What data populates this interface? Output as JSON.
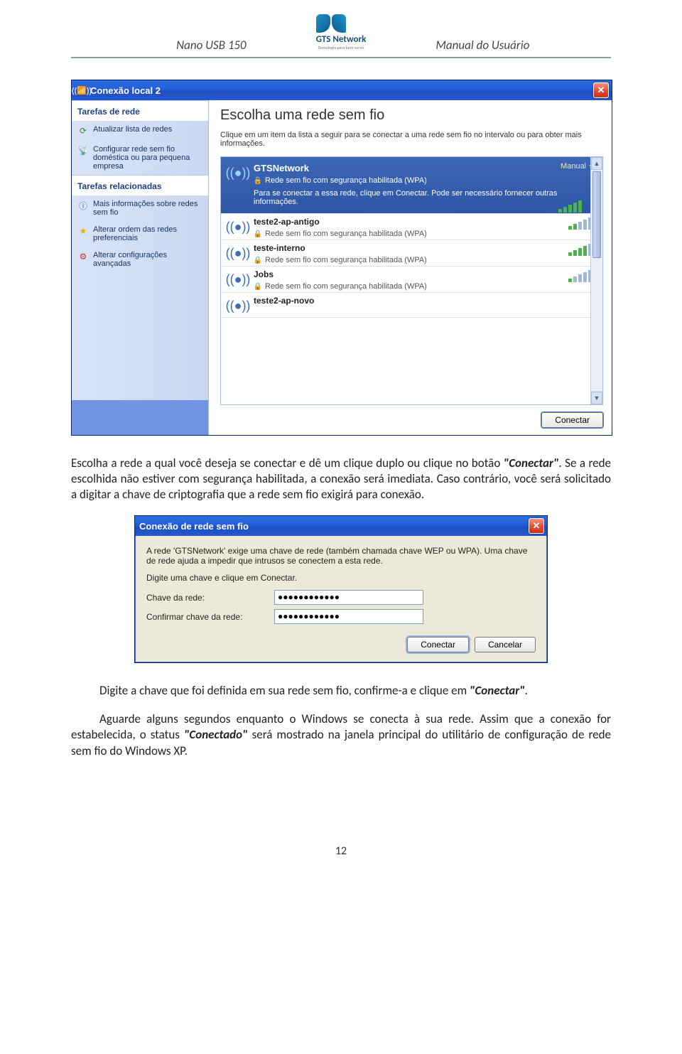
{
  "header": {
    "left": "Nano USB 150",
    "logo_text": "GTS Network",
    "logo_sub": "Tecnologia para bem servir",
    "right": "Manual do Usuário"
  },
  "win1": {
    "title": "Conexão local 2",
    "sidebar": {
      "section1": "Tarefas de rede",
      "items1": [
        {
          "label": "Atualizar lista de redes",
          "icon": "↻"
        },
        {
          "label": "Configurar rede sem fio doméstica ou para pequena empresa",
          "icon": "📶"
        }
      ],
      "section2": "Tarefas relacionadas",
      "items2": [
        {
          "label": "Mais informações sobre redes sem fio",
          "icon": "ℹ"
        },
        {
          "label": "Alterar ordem das redes preferenciais",
          "icon": "★"
        },
        {
          "label": "Alterar configurações avançadas",
          "icon": "⚙"
        }
      ]
    },
    "main": {
      "title": "Escolha uma rede sem fio",
      "subtitle": "Clique em um item da lista a seguir para se conectar a uma rede sem fio no intervalo ou para obter mais informações.",
      "selected": {
        "name": "GTSNetwork",
        "badge": "Manual",
        "security": "Rede sem fio com segurança habilitada (WPA)",
        "desc": "Para se conectar a essa rede, clique em Conectar. Pode ser necessário fornecer outras informações.",
        "bars": [
          1,
          1,
          1,
          1,
          1
        ]
      },
      "rows": [
        {
          "name": "teste2-ap-antigo",
          "sec": "Rede sem fio com segurança habilitada (WPA)",
          "bars": [
            1,
            1,
            0,
            0,
            0
          ]
        },
        {
          "name": "teste-interno",
          "sec": "Rede sem fio com segurança habilitada (WPA)",
          "bars": [
            1,
            1,
            1,
            1,
            0
          ]
        },
        {
          "name": "Jobs",
          "sec": "Rede sem fio com segurança habilitada (WPA)",
          "bars": [
            1,
            0,
            0,
            0,
            0
          ]
        },
        {
          "name": "teste2-ap-novo",
          "sec": "",
          "bars": []
        }
      ],
      "connect_btn": "Conectar"
    }
  },
  "para1": {
    "t1": "Escolha a rede a qual você deseja se conectar e dê um clique duplo ou clique no botão ",
    "b1": "\"Conectar\"",
    "t2": ". Se a rede escolhida não estiver com segurança habilitada, a conexão será imediata. Caso contrário, você será solicitado a digitar a chave de criptografia que a rede sem fio exigirá para conexão."
  },
  "win2": {
    "title": "Conexão de rede sem fio",
    "p1": "A rede 'GTSNetwork' exige uma chave de rede (também chamada chave WEP ou WPA). Uma chave de rede ajuda a impedir que intrusos se conectem a esta rede.",
    "p2": "Digite uma chave e clique em Conectar.",
    "label1": "Chave da rede:",
    "label2": "Confirmar chave da rede:",
    "val1": "●●●●●●●●●●●●",
    "val2": "●●●●●●●●●●●●",
    "btn_ok": "Conectar",
    "btn_cancel": "Cancelar"
  },
  "para2": {
    "t1": "Digite a chave que foi definida em sua rede sem fio, confirme-a e clique em ",
    "b1": "\"Conectar\"",
    "t2": "."
  },
  "para3": {
    "t1": "Aguarde alguns segundos enquanto o Windows se conecta à sua rede. Assim que a conexão for estabelecida, o status ",
    "b1": "\"Conectado\"",
    "t2": " será mostrado na janela principal do utilitário de configuração de rede sem fio do Windows XP."
  },
  "page_number": "12"
}
